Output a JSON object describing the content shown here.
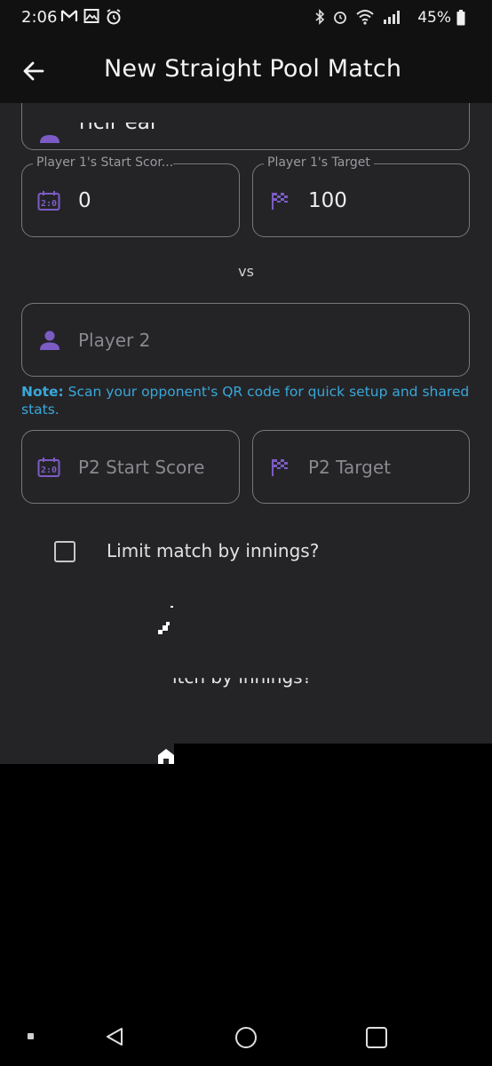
{
  "status_bar": {
    "time": "2:06",
    "battery_percent": "45%",
    "left_icons": [
      "gmail-icon",
      "gallery-icon",
      "alarm-sync-icon"
    ],
    "right_icons": [
      "bluetooth-icon",
      "alarm-icon",
      "wifi-icon",
      "signal-icon"
    ]
  },
  "app_bar": {
    "title": "New Straight Pool Match",
    "back_icon": "back-arrow-icon"
  },
  "form": {
    "player1": {
      "name_partial": "ricir eai",
      "start_score_label": "Player 1's Start Scor...",
      "start_score_value": "0",
      "target_label": "Player 1's Target",
      "target_value": "100"
    },
    "vs": "vs",
    "player2": {
      "name_placeholder": "Player 2",
      "start_score_placeholder": "P2 Start Score",
      "target_placeholder": "P2 Target"
    },
    "note": {
      "prefix": "Note:",
      "text": " Scan your opponent's QR code for quick setup and shared stats."
    },
    "limit_innings": {
      "label": "Limit match by innings?",
      "checked": false
    },
    "ghost_label": "itch by innings?"
  },
  "colors": {
    "background": "#242427",
    "accent_purple": "#7c5cc4",
    "note_blue": "#3aa7d8",
    "field_border": "#78787c"
  }
}
